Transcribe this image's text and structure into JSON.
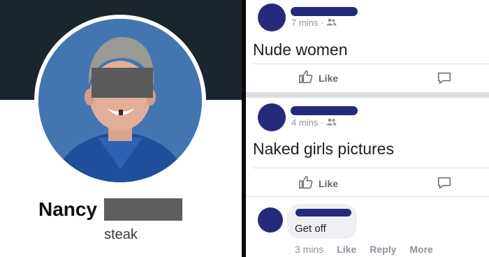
{
  "profile": {
    "name": "Nancy",
    "bio": "steak"
  },
  "posts": [
    {
      "time": "7 mins ·",
      "text": "Nude women",
      "like_label": "Like"
    },
    {
      "time": "4 mins ·",
      "text": "Naked girls pictures",
      "like_label": "Like"
    }
  ],
  "comment": {
    "text": "Get off",
    "time": "3 mins",
    "like_label": "Like",
    "reply_label": "Reply",
    "more_label": "More"
  },
  "colors": {
    "banner": "#1a2530",
    "profile_avatar_blue": "#3f72ae",
    "author_placeholder": "#262a7a",
    "censor_bar": "#5e5e5e"
  },
  "icons": {
    "like": "thumbs-up-icon",
    "comment": "speech-bubble-icon",
    "audience": "people-icon"
  }
}
